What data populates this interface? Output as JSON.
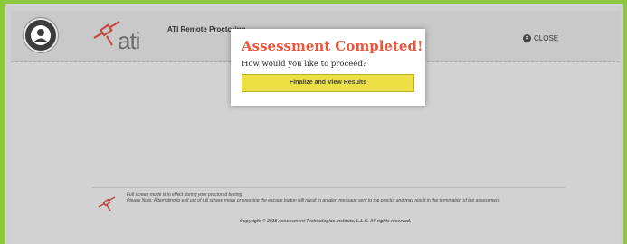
{
  "header": {
    "logo_text": "ati",
    "app_title": "ATI Remote Proctoring",
    "close_label": "CLOSE"
  },
  "modal": {
    "title": "Assessment Completed!",
    "question": "How would you like to proceed?",
    "finalize_button": "Finalize and View Results"
  },
  "footer": {
    "notice_line1": "Full screen mode is in effect during your proctored testing.",
    "notice_line2": "Please Note: Attempting to exit out of full screen mode or pressing the escape button will result in an alert message sent to the proctor and may result in the termination of the assessment.",
    "copyright": "Copyright © 2018 Assessment Technologies Institute, L.L.C. All rights reserved."
  },
  "colors": {
    "frame_accent": "#8dc63f",
    "title_red": "#e8563c",
    "button_yellow": "#ece045"
  },
  "icons": [
    "user-avatar-icon",
    "satellite-logo-icon",
    "close-circle-icon",
    "satellite-footer-icon"
  ]
}
